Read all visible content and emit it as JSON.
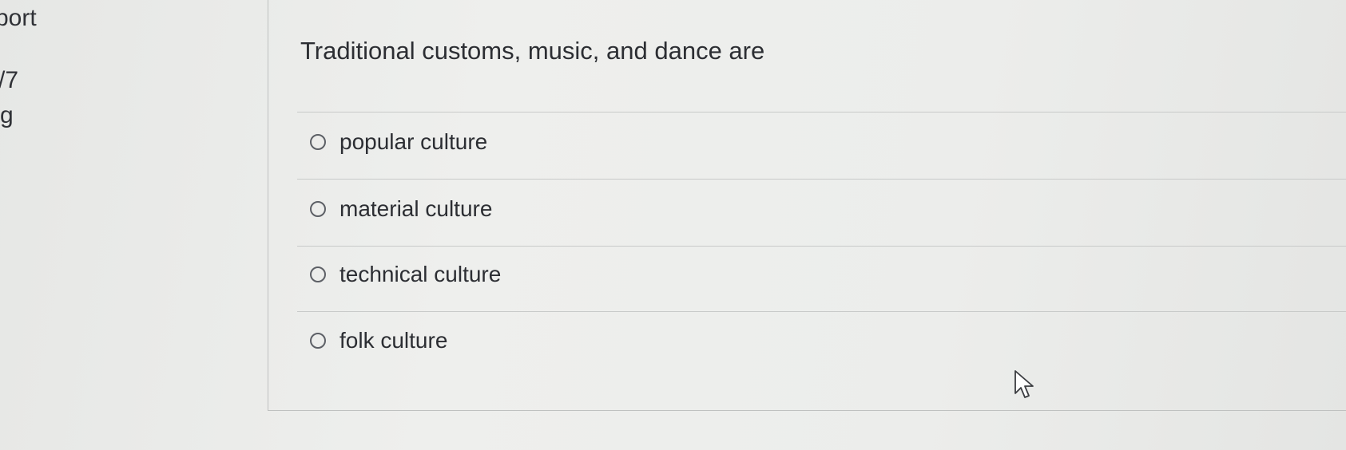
{
  "sidebar": {
    "fragments": [
      "port",
      "/7",
      "g"
    ]
  },
  "question": {
    "text": "Traditional customs, music, and dance are",
    "options": [
      {
        "label": "popular culture",
        "selected": false
      },
      {
        "label": "material culture",
        "selected": false
      },
      {
        "label": "technical culture",
        "selected": false
      },
      {
        "label": "folk culture",
        "selected": false
      }
    ]
  },
  "icons": {
    "radio": "radio-button-icon",
    "cursor": "mouse-pointer-icon"
  },
  "colors": {
    "background": "#eceeec",
    "text": "#2c2e33",
    "border": "#bfc1c0"
  }
}
